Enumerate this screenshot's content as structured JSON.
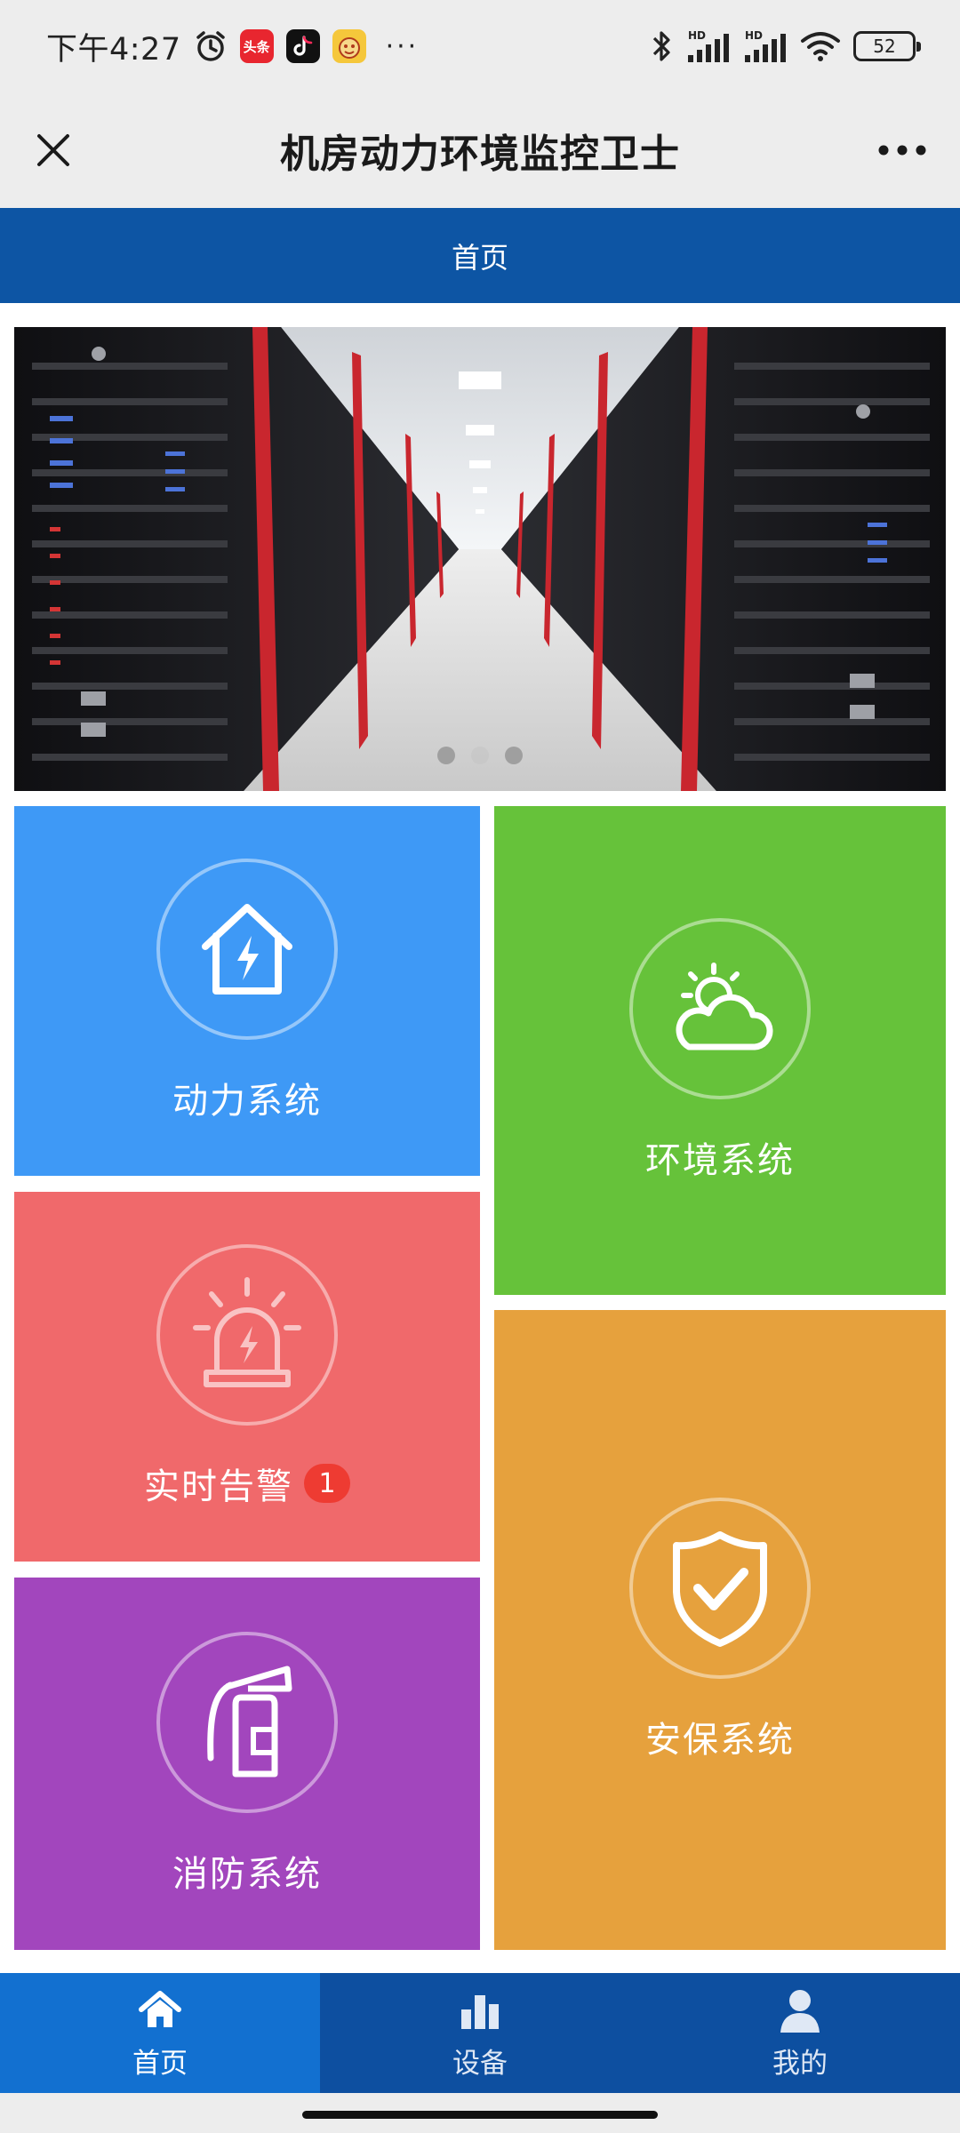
{
  "status_bar": {
    "time": "下午4:27",
    "apps": [
      "头条",
      "抖音",
      "游戏"
    ],
    "more": "···",
    "signal_label": "HD",
    "battery": "52"
  },
  "header": {
    "title": "机房动力环境监控卫士"
  },
  "page_bar": {
    "title": "首页"
  },
  "banner": {
    "slides": 3,
    "active_slide": 1
  },
  "tiles": {
    "power": {
      "label": "动力系统",
      "icon": "house-lightning-icon",
      "color": "#3e99f6"
    },
    "environment": {
      "label": "环境系统",
      "icon": "sun-cloud-icon",
      "color": "#66c23a"
    },
    "alarm": {
      "label": "实时告警",
      "badge": "1",
      "icon": "alarm-siren-icon",
      "color": "#f0696b"
    },
    "security": {
      "label": "安保系统",
      "icon": "shield-check-icon",
      "color": "#e6a13d"
    },
    "fire": {
      "label": "消防系统",
      "icon": "fire-extinguisher-icon",
      "color": "#a246bd"
    }
  },
  "bottom_nav": {
    "items": [
      {
        "label": "首页",
        "icon": "home-icon",
        "active": true
      },
      {
        "label": "设备",
        "icon": "bar-chart-icon",
        "active": false
      },
      {
        "label": "我的",
        "icon": "user-icon",
        "active": false
      }
    ]
  },
  "colors": {
    "primary": "#0d55a4",
    "nav_active": "#1270d0",
    "badge": "#ee3b32"
  }
}
